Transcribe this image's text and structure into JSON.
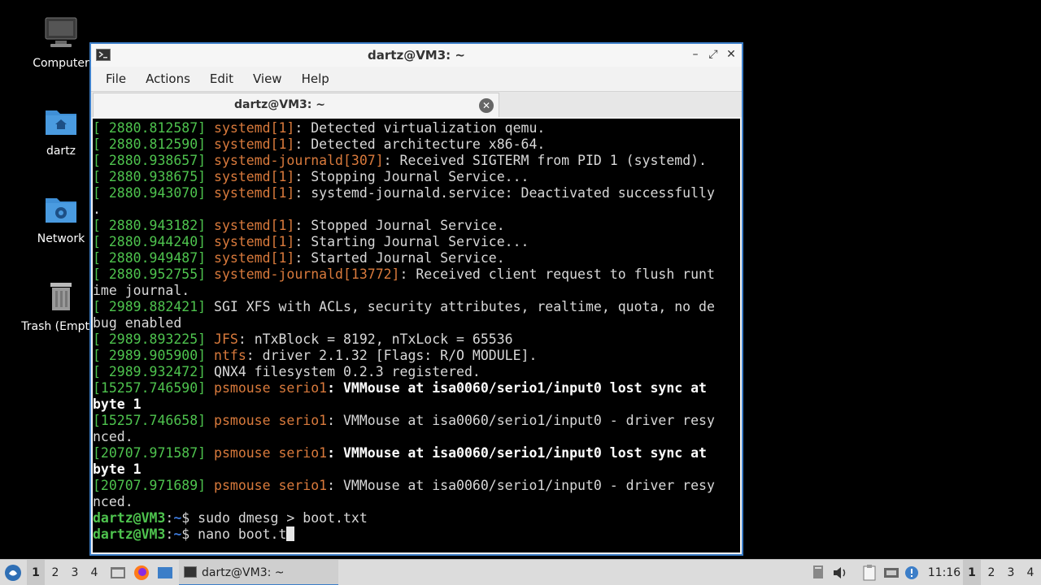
{
  "desktop": {
    "icons": [
      {
        "label": "Computer",
        "icon": "computer-icon"
      },
      {
        "label": "dartz",
        "icon": "home-folder-icon"
      },
      {
        "label": "Network",
        "icon": "network-folder-icon"
      },
      {
        "label": "Trash (Empty)",
        "icon": "trash-icon"
      }
    ]
  },
  "window": {
    "title": "dartz@VM3: ~",
    "minimize": "–",
    "maximize": "⤢",
    "close": "✕"
  },
  "menubar": [
    "File",
    "Actions",
    "Edit",
    "View",
    "Help"
  ],
  "tab": {
    "label": "dartz@VM3: ~"
  },
  "terminal": {
    "lines": [
      [
        [
          "ts",
          "[ 2880.812587] "
        ],
        [
          "src",
          "systemd[1]"
        ],
        [
          "n",
          ": Detected virtualization qemu."
        ]
      ],
      [
        [
          "ts",
          "[ 2880.812590] "
        ],
        [
          "src",
          "systemd[1]"
        ],
        [
          "n",
          ": Detected architecture x86-64."
        ]
      ],
      [
        [
          "ts",
          "[ 2880.938657] "
        ],
        [
          "src",
          "systemd-journald[307]"
        ],
        [
          "n",
          ": Received SIGTERM from PID 1 (systemd)."
        ]
      ],
      [
        [
          "ts",
          "[ 2880.938675] "
        ],
        [
          "src",
          "systemd[1]"
        ],
        [
          "n",
          ": Stopping Journal Service..."
        ]
      ],
      [
        [
          "ts",
          "[ 2880.943070] "
        ],
        [
          "src",
          "systemd[1]"
        ],
        [
          "n",
          ": systemd-journald.service: Deactivated successfully"
        ]
      ],
      [
        [
          "n",
          "."
        ]
      ],
      [
        [
          "ts",
          "[ 2880.943182] "
        ],
        [
          "src",
          "systemd[1]"
        ],
        [
          "n",
          ": Stopped Journal Service."
        ]
      ],
      [
        [
          "ts",
          "[ 2880.944240] "
        ],
        [
          "src",
          "systemd[1]"
        ],
        [
          "n",
          ": Starting Journal Service..."
        ]
      ],
      [
        [
          "ts",
          "[ 2880.949487] "
        ],
        [
          "src",
          "systemd[1]"
        ],
        [
          "n",
          ": Started Journal Service."
        ]
      ],
      [
        [
          "ts",
          "[ 2880.952755] "
        ],
        [
          "src",
          "systemd-journald[13772]"
        ],
        [
          "n",
          ": Received client request to flush runt"
        ]
      ],
      [
        [
          "n",
          "ime journal."
        ]
      ],
      [
        [
          "ts",
          "[ 2989.882421] "
        ],
        [
          "n",
          "SGI XFS with ACLs, security attributes, realtime, quota, no de"
        ]
      ],
      [
        [
          "n",
          "bug enabled"
        ]
      ],
      [
        [
          "ts",
          "[ 2989.893225] "
        ],
        [
          "src",
          "JFS"
        ],
        [
          "n",
          ": nTxBlock = 8192, nTxLock = 65536"
        ]
      ],
      [
        [
          "ts",
          "[ 2989.905900] "
        ],
        [
          "src",
          "ntfs"
        ],
        [
          "n",
          ": driver 2.1.32 [Flags: R/O MODULE]."
        ]
      ],
      [
        [
          "ts",
          "[ 2989.932472] "
        ],
        [
          "n",
          "QNX4 filesystem 0.2.3 registered."
        ]
      ],
      [
        [
          "ts",
          "[15257.746590] "
        ],
        [
          "src",
          "psmouse serio1"
        ],
        [
          "hi",
          ": VMMouse at isa0060/serio1/input0 lost sync at"
        ]
      ],
      [
        [
          "hi",
          "byte 1"
        ]
      ],
      [
        [
          "ts",
          "[15257.746658] "
        ],
        [
          "src",
          "psmouse serio1"
        ],
        [
          "n",
          ": VMMouse at isa0060/serio1/input0 - driver resy"
        ]
      ],
      [
        [
          "n",
          "nced."
        ]
      ],
      [
        [
          "ts",
          "[20707.971587] "
        ],
        [
          "src",
          "psmouse serio1"
        ],
        [
          "hi",
          ": VMMouse at isa0060/serio1/input0 lost sync at"
        ]
      ],
      [
        [
          "hi",
          "byte 1"
        ]
      ],
      [
        [
          "ts",
          "[20707.971689] "
        ],
        [
          "src",
          "psmouse serio1"
        ],
        [
          "n",
          ": VMMouse at isa0060/serio1/input0 - driver resy"
        ]
      ],
      [
        [
          "n",
          "nced."
        ]
      ]
    ],
    "prompts": [
      {
        "user": "dartz@VM3",
        "sep": ":",
        "path": "~",
        "sym": "$ ",
        "cmd": "sudo dmesg > boot.txt"
      },
      {
        "user": "dartz@VM3",
        "sep": ":",
        "path": "~",
        "sym": "$ ",
        "cmd": "nano boot.t"
      }
    ]
  },
  "taskbar": {
    "workspaces_left": [
      "1",
      "2",
      "3",
      "4"
    ],
    "task_label": "dartz@VM3: ~",
    "clock": "11:16",
    "workspaces_right": [
      "1",
      "2",
      "3",
      "4"
    ]
  }
}
